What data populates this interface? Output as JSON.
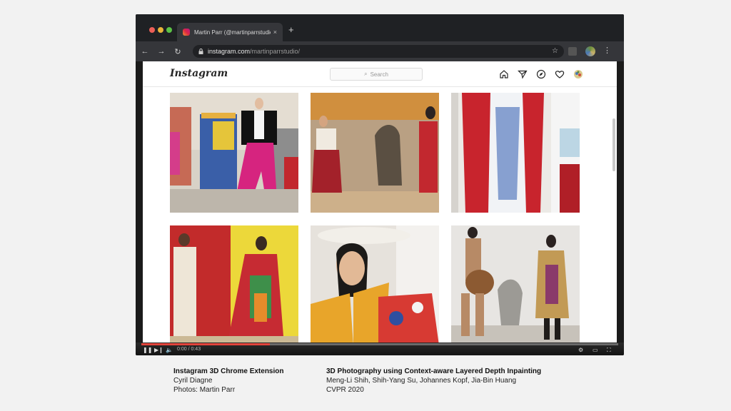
{
  "browser": {
    "tab_title": "Martin Parr (@martinparrstudio)",
    "tab_close": "×",
    "new_tab": "+",
    "url_host": "instagram.com",
    "url_path": "/martinparrstudio/",
    "nav_back": "←",
    "nav_forward": "→",
    "nav_reload": "↻",
    "star": "☆",
    "menu": "⋮"
  },
  "instagram": {
    "logo": "Instagram",
    "search_placeholder": "Search",
    "icons": [
      "home-icon",
      "direct-icon",
      "explore-icon",
      "heart-icon",
      "profile-icon"
    ]
  },
  "video": {
    "play_pause": "❚❚",
    "next": "▶❙",
    "volume": "🔈",
    "time": "0:00 / 0:43",
    "progress": 0.27
  },
  "captions": {
    "left": {
      "title": "Instagram 3D Chrome Extension",
      "line1": "Cyril Diagne",
      "line2": "Photos: Martin Parr"
    },
    "right": {
      "title": "3D Photography using Context-aware Layered Depth Inpainting",
      "line1": "Meng-Li Shih, Shih-Yang Su, Johannes Kopf, Jia-Bin Huang",
      "line2": "CVPR 2020"
    }
  }
}
